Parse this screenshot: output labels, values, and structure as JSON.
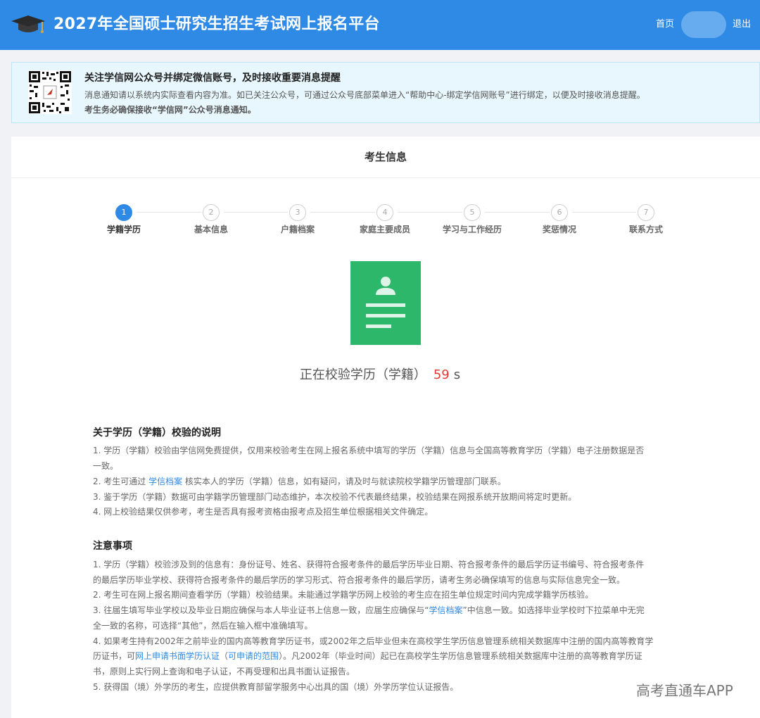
{
  "header": {
    "site_title": "2027年全国硕士研究生招生考试网上报名平台",
    "home_label": "首页",
    "logout_label": "退出",
    "bg_color": "#2f8ae5"
  },
  "notice": {
    "title": "关注学信网公众号并绑定微信账号，及时接收重要消息提醒",
    "line1": "消息通知请以系统内实际查看内容为准。如已关注公众号，可通过公众号底部菜单进入“帮助中心-绑定学信网账号”进行绑定，以便及时接收消息提醒。",
    "line2": "考生务必确保接收“学信网”公众号消息通知。"
  },
  "card": {
    "title": "考生信息"
  },
  "steps": [
    {
      "number": "1",
      "label": "学籍学历",
      "active": true
    },
    {
      "number": "2",
      "label": "基本信息",
      "active": false
    },
    {
      "number": "3",
      "label": "户籍档案",
      "active": false
    },
    {
      "number": "4",
      "label": "家庭主要成员",
      "active": false
    },
    {
      "number": "5",
      "label": "学习与工作经历",
      "active": false
    },
    {
      "number": "6",
      "label": "奖惩情况",
      "active": false
    },
    {
      "number": "7",
      "label": "联系方式",
      "active": false
    }
  ],
  "verify": {
    "text": "正在校验学历（学籍）",
    "countdown": "59",
    "unit": "s",
    "icon_color": "#2cb76b",
    "countdown_color": "#e53935"
  },
  "about": {
    "title": "关于学历（学籍）校验的说明",
    "p1_line1": "1. 学历（学籍）校验由学信网免费提供，仅用来校验考生在网上报名系统中填写的学历（学籍）信息与全国高等教育学历（学籍）电子注册数据是否",
    "p1_line2": "一致。",
    "p2_before": "2. 考生可通过 ",
    "p2_link": "学信档案",
    "p2_after": " 核实本人的学历（学籍）信息，如有疑问，请及时与就读院校学籍学历管理部门联系。",
    "p3": "3. 鉴于学历（学籍）数据可由学籍学历管理部门动态维护，本次校验不代表最终结果，校验结果在网报系统开放期间将定时更新。",
    "p4": "4. 网上校验结果仅供参考，考生是否具有报考资格由报考点及招生单位根据相关文件确定。"
  },
  "notes": {
    "title": "注意事项",
    "n1_line1": "1. 学历（学籍）校验涉及到的信息有：身份证号、姓名、获得符合报考条件的最后学历毕业日期、符合报考条件的最后学历证书编号、符合报考条件",
    "n1_line2": "的最后学历毕业学校、获得符合报考条件的最后学历的学习形式、符合报考条件的最后学历，请考生务必确保填写的信息与实际信息完全一致。",
    "n2": "2. 考生可在网上报名期间查看学历（学籍）校验结果。未能通过学籍学历网上校验的考生应在招生单位规定时间内完成学籍学历核验。",
    "n3_before": "3. 往届生填写毕业学校以及毕业日期应确保与本人毕业证书上信息一致，应届生应确保与“",
    "n3_link": "学信档案",
    "n3_after": "”中信息一致。如选择毕业学校时下拉菜单中无完",
    "n3_line2": "全一致的名称，可选择“其他”，然后在输入框中准确填写。",
    "n4_line1": "4. 如果考生持有2002年之前毕业的国内高等教育学历证书，或2002年之后毕业但未在高校学生学历信息管理系统相关数据库中注册的国内高等教育学",
    "n4_before": "历证书，可",
    "n4_link1": "网上申请书面学历认证",
    "n4_mid": "（",
    "n4_link2": "可申请的范围",
    "n4_after": "）。凡2002年（毕业时间）起已在高校学生学历信息管理系统相关数据库中注册的高等教育学历证",
    "n4_line3": "书，原则上实行网上查询和电子认证，不再受理和出具书面认证报告。",
    "n5": "5. 获得国（境）外学历的考生，应提供教育部留学服务中心出具的国（境）外学历学位认证报告。"
  },
  "watermark": "高考直通车APP"
}
